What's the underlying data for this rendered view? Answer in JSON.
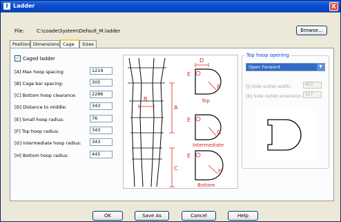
{
  "window": {
    "title": "Ladder",
    "close_glyph": "X"
  },
  "file": {
    "label": "File:",
    "path": "C:\\coade\\System\\Default_M.ladder",
    "browse_label": "Browse..."
  },
  "tabs": [
    "Position",
    "Dimensions",
    "Cage",
    "Sizes"
  ],
  "active_tab": "Cage",
  "caged_ladder": {
    "label": "Caged ladder",
    "checked": true
  },
  "fields": [
    {
      "label": "[A] Max hoop spacing:",
      "value": "1219"
    },
    {
      "label": "[B] Cage bar spacing:",
      "value": "305"
    },
    {
      "label": "[C] Bottom hoop clearance:",
      "value": "2286"
    },
    {
      "label": "[D] Distance to middle:",
      "value": "343"
    },
    {
      "label": "[E] Small hoop radius:",
      "value": "76"
    },
    {
      "label": "[F] Top hoop radius:",
      "value": "343"
    },
    {
      "label": "[G] Intermediate hoop radius:",
      "value": "343"
    },
    {
      "label": "[H] Bottom hoop radius:",
      "value": "445"
    }
  ],
  "diagram": {
    "letters": {
      "a": "A",
      "b": "B",
      "c": "C",
      "d": "D",
      "e1": "E",
      "e2": "E",
      "e3": "E",
      "f": "F",
      "g": "G",
      "h": "H"
    },
    "captions": {
      "top": "Top",
      "intermediate": "Intermediate",
      "bottom": "Bottom"
    }
  },
  "top_hoop": {
    "group_title": "Top hoop opening",
    "selected": "Open Forward",
    "side_outlet_width_label": "[J] Side outlet width:",
    "side_outlet_width_value": "457",
    "side_outlet_extension_label": "[K] Side outlet extension:",
    "side_outlet_extension_value": "127"
  },
  "buttons": {
    "ok": "OK",
    "save_as": "Save As",
    "cancel": "Cancel",
    "help": "Help"
  },
  "colors": {
    "titlebar": "#0a4fd0",
    "annotation": "#e02020",
    "selection": "#316ac5",
    "dialog_bg": "#ece9d8"
  }
}
